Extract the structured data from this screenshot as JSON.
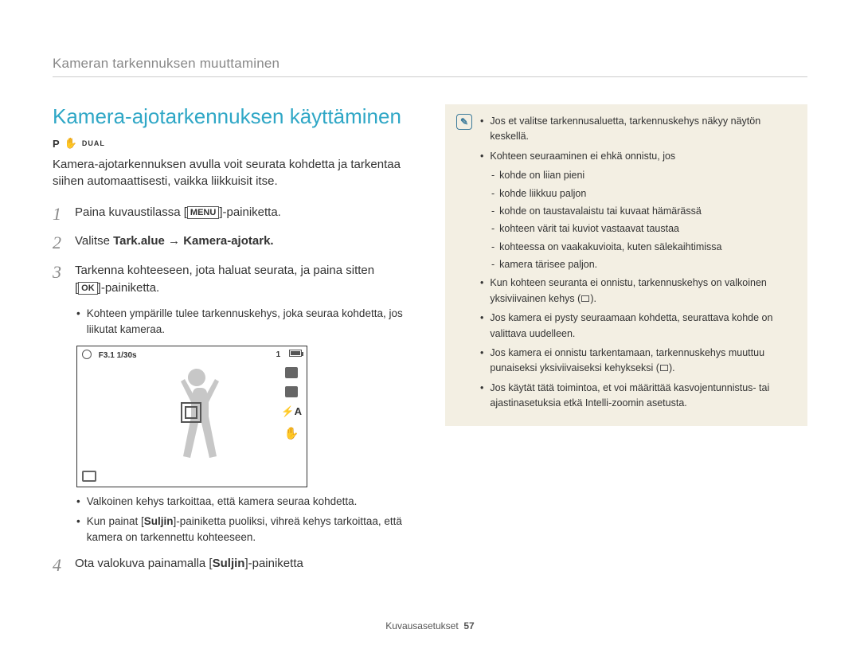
{
  "header": {
    "breadcrumb": "Kameran tarkennuksen muuttaminen"
  },
  "title": "Kamera-ajotarkennuksen käyttäminen",
  "mode": {
    "p": "P",
    "dual": "DUAL"
  },
  "intro": "Kamera-ajotarkennuksen avulla voit seurata kohdetta ja tarkentaa siihen automaattisesti, vaikka liikkuisit itse.",
  "steps": {
    "s1": {
      "num": "1",
      "pre": "Paina kuvaustilassa [",
      "btn": "MENU",
      "post": "]-painiketta."
    },
    "s2": {
      "num": "2",
      "pre": "Valitse ",
      "bold1": "Tark.alue",
      "arrow": " → ",
      "bold2": "Kamera-ajotark."
    },
    "s3": {
      "num": "3",
      "line1": "Tarkenna kohteeseen, jota haluat seurata, ja paina sitten",
      "line2_pre": "[",
      "line2_btn": "OK",
      "line2_post": "]-painiketta.",
      "bullet1": "Kohteen ympärille tulee tarkennuskehys, joka seuraa kohdetta, jos liikutat kameraa."
    },
    "bullets_after_image": {
      "b1": "Valkoinen kehys tarkoittaa, että kamera seuraa kohdetta.",
      "b2_pre": "Kun painat [",
      "b2_bold": "Suljin",
      "b2_post": "]-painiketta puoliksi, vihreä kehys tarkoittaa, että kamera on tarkennettu kohteeseen."
    },
    "s4": {
      "num": "4",
      "pre": "Ota valokuva painamalla [",
      "bold": "Suljin",
      "post": "]-painiketta"
    }
  },
  "camera_screen": {
    "top_left": "F3.1  1/30s",
    "top_right": "1"
  },
  "notes": {
    "n1": "Jos et valitse tarkennusaluetta, tarkennuskehys näkyy näytön keskellä.",
    "n2_lead": "Kohteen seuraaminen ei ehkä onnistu, jos",
    "n2_d1": "kohde on liian pieni",
    "n2_d2": "kohde liikkuu paljon",
    "n2_d3": "kohde on taustavalaistu tai kuvaat hämärässä",
    "n2_d4": "kohteen värit tai kuviot vastaavat taustaa",
    "n2_d5": "kohteessa on vaakakuvioita, kuten sälekaihtimissa",
    "n2_d6": "kamera tärisee paljon.",
    "n3_pre": "Kun kohteen seuranta ei onnistu, tarkennuskehys on valkoinen yksiviivainen kehys (",
    "n3_post": ").",
    "n4": "Jos kamera ei pysty seuraamaan kohdetta, seurattava kohde on valittava uudelleen.",
    "n5_pre": "Jos kamera ei onnistu tarkentamaan, tarkennuskehys muuttuu punaiseksi yksiviivaiseksi kehykseksi (",
    "n5_post": ").",
    "n6": "Jos käytät tätä toimintoa, et voi määrittää kasvojentunnistus- tai ajastinasetuksia etkä Intelli-zoomin asetusta."
  },
  "footer": {
    "section": "Kuvausasetukset",
    "page": "57"
  }
}
